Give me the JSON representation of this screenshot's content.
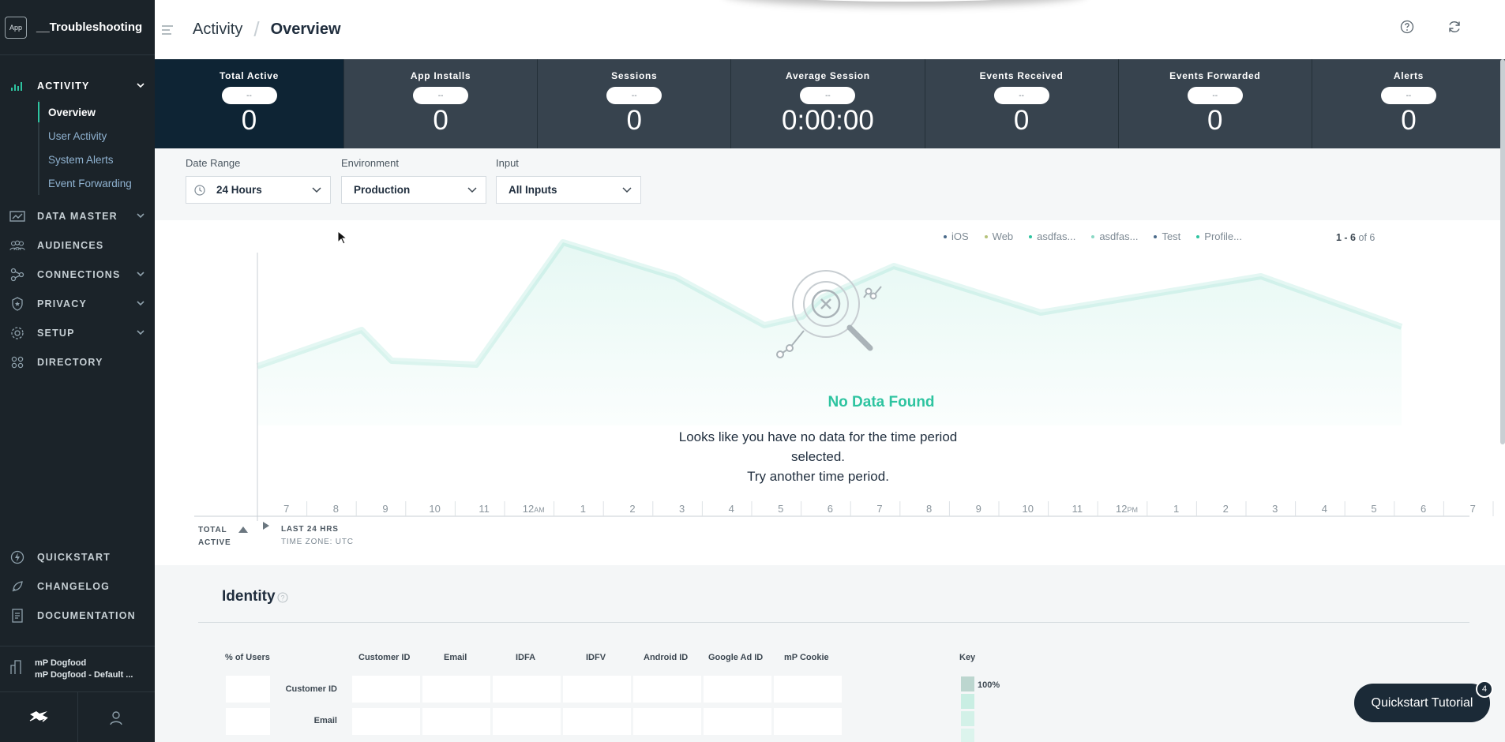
{
  "app": {
    "badge": "App",
    "name": "__Troubleshooting"
  },
  "nav": {
    "activity": "ACTIVITY",
    "activity_sub": [
      "Overview",
      "User Activity",
      "System Alerts",
      "Event Forwarding"
    ],
    "data_master": "DATA MASTER",
    "audiences": "AUDIENCES",
    "connections": "CONNECTIONS",
    "privacy": "PRIVACY",
    "setup": "SETUP",
    "directory": "DIRECTORY",
    "quickstart": "QUICKSTART",
    "changelog": "CHANGELOG",
    "documentation": "DOCUMENTATION"
  },
  "org": {
    "line1": "mP Dogfood",
    "line2": "mP Dogfood - Default ..."
  },
  "header": {
    "section": "Activity",
    "page": "Overview"
  },
  "stats": [
    {
      "label": "Total Active",
      "pill": "--",
      "value": "0"
    },
    {
      "label": "App Installs",
      "pill": "--",
      "value": "0"
    },
    {
      "label": "Sessions",
      "pill": "--",
      "value": "0"
    },
    {
      "label": "Average Session",
      "pill": "--",
      "value": "0:00:00"
    },
    {
      "label": "Events Received",
      "pill": "--",
      "value": "0"
    },
    {
      "label": "Events Forwarded",
      "pill": "--",
      "value": "0"
    },
    {
      "label": "Alerts",
      "pill": "--",
      "value": "0"
    }
  ],
  "filters": {
    "date_range": {
      "label": "Date Range",
      "value": "24 Hours"
    },
    "environment": {
      "label": "Environment",
      "value": "Production"
    },
    "input": {
      "label": "Input",
      "value": "All Inputs"
    }
  },
  "legend": [
    {
      "name": "iOS",
      "color": "#4a6a8a"
    },
    {
      "name": "Web",
      "color": "#b5c27a"
    },
    {
      "name": "asdfas...",
      "color": "#2ec4a0"
    },
    {
      "name": "asdfas...",
      "color": "#8ad8c4"
    },
    {
      "name": "Test",
      "color": "#4a6a8a"
    },
    {
      "name": "Profile...",
      "color": "#2ec4a0"
    }
  ],
  "pager": {
    "range": "1 - 6",
    "of": "of 6"
  },
  "empty_state": {
    "title": "No Data Found",
    "line1": "Looks like you have no data for the time period selected.",
    "line2": "Try another time period."
  },
  "xaxis": {
    "ticks": [
      "7",
      "8",
      "9",
      "10",
      "11",
      "12",
      "1",
      "2",
      "3",
      "4",
      "5",
      "6",
      "7",
      "8",
      "9",
      "10",
      "11",
      "12",
      "1",
      "2",
      "3",
      "4",
      "5",
      "6",
      "7"
    ],
    "am": "AM",
    "pm": "PM",
    "left_label_1": "TOTAL",
    "left_label_2": "ACTIVE",
    "range_label": "LAST 24 HRS",
    "timezone": "TIME ZONE: UTC"
  },
  "identity": {
    "title": "Identity",
    "pct_header": "% of Users",
    "columns": [
      "Customer ID",
      "Email",
      "IDFA",
      "IDFV",
      "Android ID",
      "Google Ad ID",
      "mP Cookie"
    ],
    "rows": [
      "Customer ID",
      "Email"
    ],
    "key_label": "Key",
    "key_pct": "100%"
  },
  "quickstart": {
    "label": "Quickstart Tutorial",
    "badge": "4"
  },
  "colors": {
    "accent": "#2ec4a0",
    "sidebar": "#1b2329",
    "stat_active": "#0e2434",
    "stat_bg": "#37434e"
  }
}
